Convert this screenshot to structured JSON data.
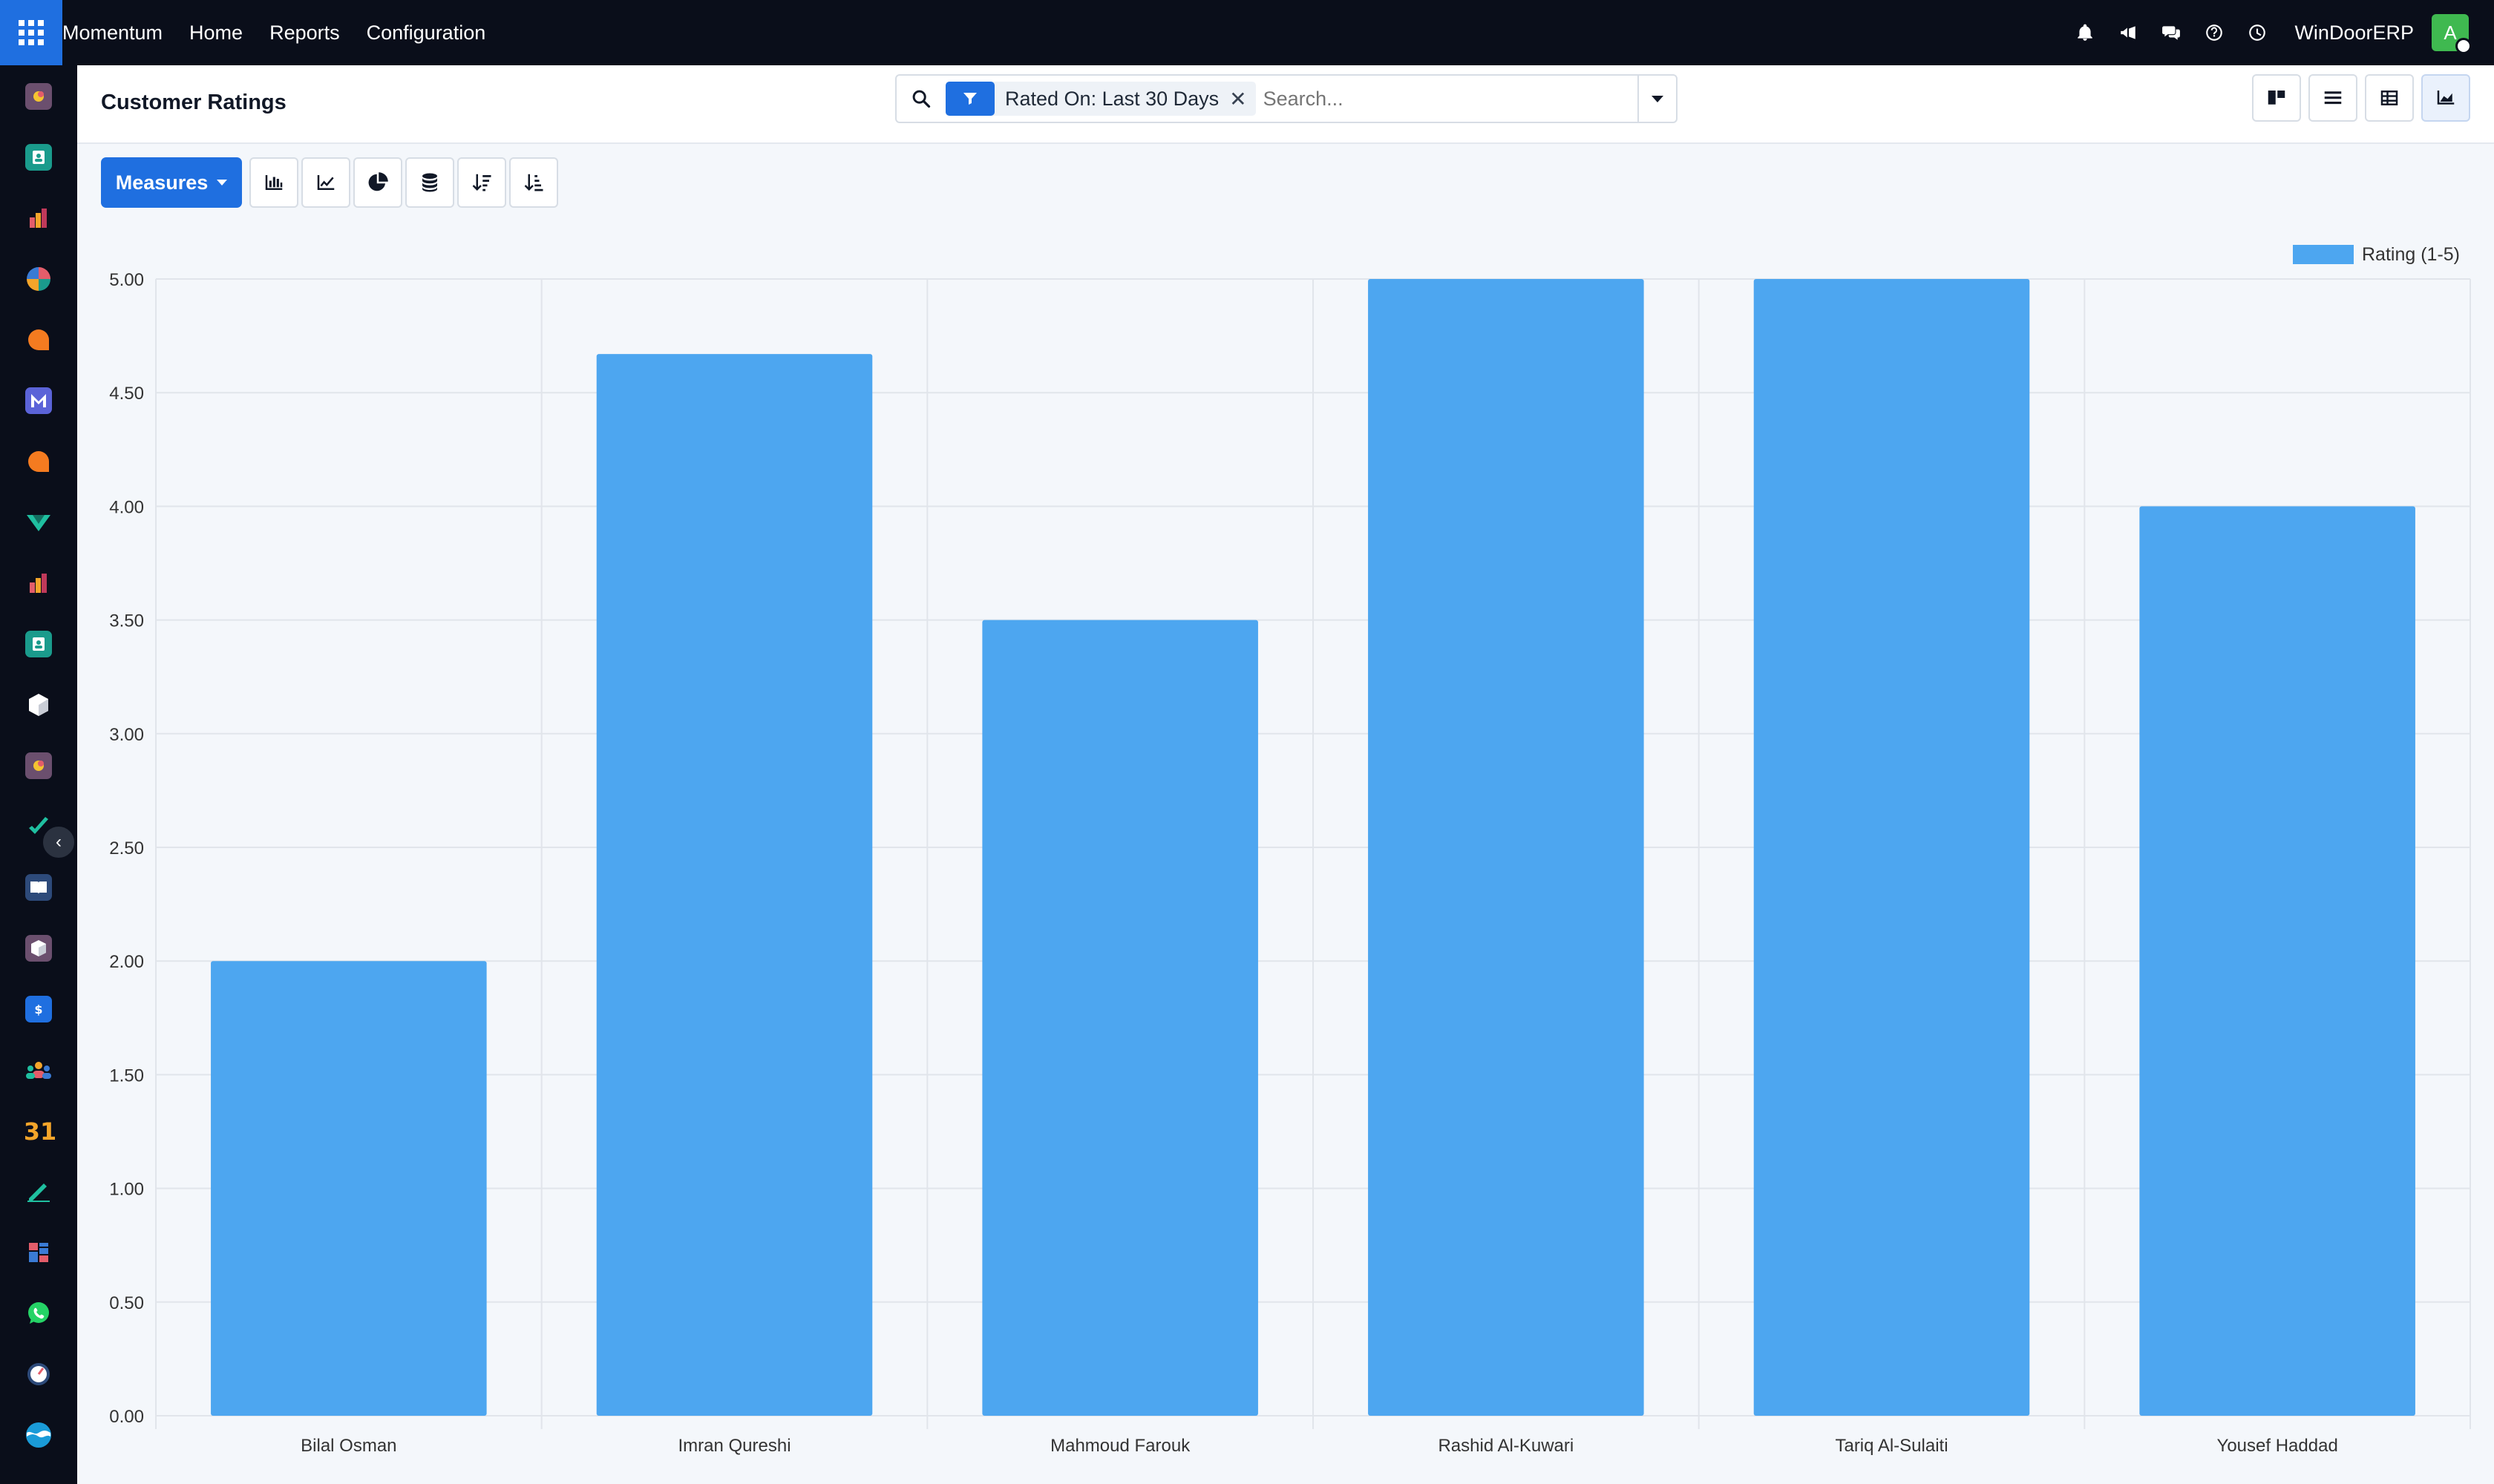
{
  "navbar": {
    "brand": "Momentum",
    "menu": [
      "Home",
      "Reports",
      "Configuration"
    ],
    "company": "WinDoorERP",
    "avatar_initial": "A",
    "icons": [
      "bell-icon",
      "megaphone-icon",
      "chat-icon",
      "help-icon",
      "clock-icon"
    ]
  },
  "control_panel": {
    "title": "Customer Ratings",
    "facet_label": "Rated On: Last 30 Days",
    "facet_close": "✕",
    "search_placeholder": "Search..."
  },
  "toolbar": {
    "measures_label": "Measures"
  },
  "colors": {
    "navbar": "#0a0e1a",
    "accent": "#1f6fe0",
    "bar": "#4da6f0"
  },
  "chart_data": {
    "type": "bar",
    "categories": [
      "Bilal Osman",
      "Imran Qureshi",
      "Mahmoud Farouk",
      "Rashid Al-Kuwari",
      "Tariq Al-Sulaiti",
      "Yousef Haddad"
    ],
    "series": [
      {
        "name": "Rating (1-5)",
        "values": [
          2.0,
          4.67,
          3.5,
          5.0,
          5.0,
          4.0
        ]
      }
    ],
    "ylim": [
      0,
      5
    ],
    "yticks": [
      "0.00",
      "0.50",
      "1.00",
      "1.50",
      "2.00",
      "2.50",
      "3.00",
      "3.50",
      "4.00",
      "4.50",
      "5.00"
    ],
    "grid": true,
    "legend": "top-right"
  }
}
